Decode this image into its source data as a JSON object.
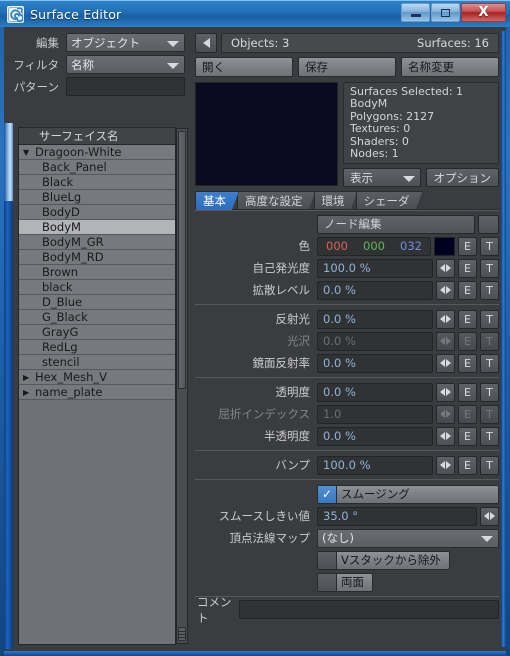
{
  "window": {
    "title": "Surface Editor",
    "icon": "app-spiral-icon",
    "buttons": {
      "minimize": "minimize-icon",
      "maximize": "maximize-icon",
      "close": "X"
    }
  },
  "left": {
    "edit": {
      "label": "編集",
      "value": "オブジェクト"
    },
    "filter": {
      "label": "フィルタ",
      "value": "名称"
    },
    "pattern": {
      "label": "パターン",
      "value": ""
    },
    "list_header": "サーフェイス名",
    "items": [
      {
        "label": "Dragoon-White",
        "type": "group",
        "expanded": true,
        "selected": false
      },
      {
        "label": "Back_Panel",
        "type": "child",
        "selected": false
      },
      {
        "label": "Black",
        "type": "child",
        "selected": false
      },
      {
        "label": "BlueLg",
        "type": "child",
        "selected": false
      },
      {
        "label": "BodyD",
        "type": "child",
        "selected": false
      },
      {
        "label": "BodyM",
        "type": "child",
        "selected": true
      },
      {
        "label": "BodyM_GR",
        "type": "child",
        "selected": false
      },
      {
        "label": "BodyM_RD",
        "type": "child",
        "selected": false
      },
      {
        "label": "Brown",
        "type": "child",
        "selected": false
      },
      {
        "label": "black",
        "type": "child",
        "selected": false
      },
      {
        "label": "D_Blue",
        "type": "child",
        "selected": false
      },
      {
        "label": "G_Black",
        "type": "child",
        "selected": false
      },
      {
        "label": "GrayG",
        "type": "child",
        "selected": false
      },
      {
        "label": "RedLg",
        "type": "child",
        "selected": false
      },
      {
        "label": "stencil",
        "type": "child",
        "selected": false
      },
      {
        "label": "Hex_Mesh_V",
        "type": "group",
        "expanded": false,
        "selected": false
      },
      {
        "label": "name_plate",
        "type": "group",
        "expanded": false,
        "selected": false
      }
    ]
  },
  "right": {
    "back_button": "left-triangle",
    "counts": {
      "objects": "Objects: 3",
      "surfaces": "Surfaces: 16"
    },
    "file_buttons": [
      {
        "label": "開く",
        "name": "open-button"
      },
      {
        "label": "保存",
        "name": "save-button"
      },
      {
        "label": "名称変更",
        "name": "rename-button"
      }
    ],
    "info": {
      "lines": [
        "Surfaces Selected: 1",
        "BodyM",
        "Polygons: 2127",
        "Textures: 0",
        "Shaders: 0",
        "Nodes: 1"
      ]
    },
    "display_button": "表示",
    "options_button": "オプション",
    "tabs": [
      {
        "label": "基本",
        "active": true
      },
      {
        "label": "高度な設定",
        "active": false
      },
      {
        "label": "環境",
        "active": false
      },
      {
        "label": "シェーダ",
        "active": false
      }
    ],
    "node_edit_button": "ノード編集",
    "color": {
      "label": "色",
      "r": "000",
      "g": "000",
      "b": "032",
      "swatch_hex": "#000020",
      "r_hex": "#d4645c",
      "g_hex": "#5cb85c",
      "b_hex": "#6f8ee8",
      "envelope": "E",
      "texture": "T"
    },
    "group1": [
      {
        "label": "自己発光度",
        "value": "100.0 %",
        "disabled": false
      },
      {
        "label": "拡散レベル",
        "value": "0.0 %",
        "disabled": false
      }
    ],
    "group2": [
      {
        "label": "反射光",
        "value": "0.0 %",
        "disabled": false
      },
      {
        "label": "光沢",
        "value": "0.0 %",
        "disabled": true
      },
      {
        "label": "鏡面反射率",
        "value": "0.0 %",
        "disabled": false
      }
    ],
    "group3": [
      {
        "label": "透明度",
        "value": "0.0 %",
        "disabled": false
      },
      {
        "label": "屈折インデックス",
        "value": "1.0",
        "disabled": true
      },
      {
        "label": "半透明度",
        "value": "0.0 %",
        "disabled": false
      }
    ],
    "group4": [
      {
        "label": "バンプ",
        "value": "100.0 %",
        "disabled": false
      }
    ],
    "smoothing": {
      "label": "スムージング",
      "checked": true
    },
    "smooth_threshold": {
      "label": "スムースしきい値",
      "value": "35.0 °"
    },
    "vertex_normal_map": {
      "label": "頂点法線マップ",
      "value": "(なし)"
    },
    "exclude_vstack": {
      "label": "Vスタックから除外",
      "checked": false
    },
    "double_sided": {
      "label": "両面",
      "checked": false
    },
    "comment": {
      "label": "コメント",
      "value": ""
    },
    "envelope_label": "E",
    "texture_label": "T"
  }
}
